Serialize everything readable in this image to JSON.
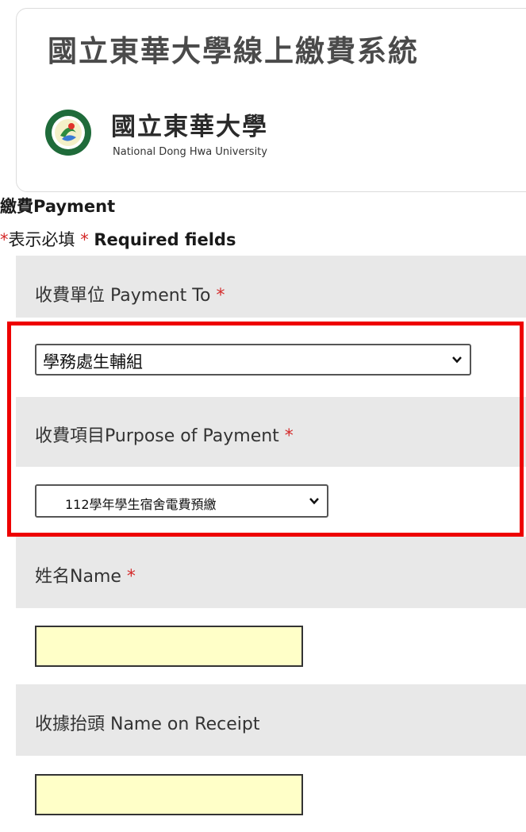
{
  "header": {
    "title": "國立東華大學線上繳費系統",
    "logo_cn": "國立東華大學",
    "logo_en": "National Dong Hwa University"
  },
  "form": {
    "heading": "繳費Payment",
    "required_star": "*",
    "required_note_cn": "表示必填",
    "required_note_en": "Required fields",
    "payment_to": {
      "label": "收費單位 Payment To",
      "selected": "學務處生輔組"
    },
    "purpose": {
      "label": "收費項目Purpose of Payment",
      "selected": "112學年學生宿舍電費預繳"
    },
    "name": {
      "label": "姓名Name",
      "value": ""
    },
    "receipt": {
      "label": "收據抬頭 Name on Receipt",
      "value": ""
    }
  },
  "colors": {
    "required": "#d42a2a",
    "highlight": "#ee0000",
    "input_bg": "#ffffc8",
    "band_bg": "#e8e8e8"
  }
}
